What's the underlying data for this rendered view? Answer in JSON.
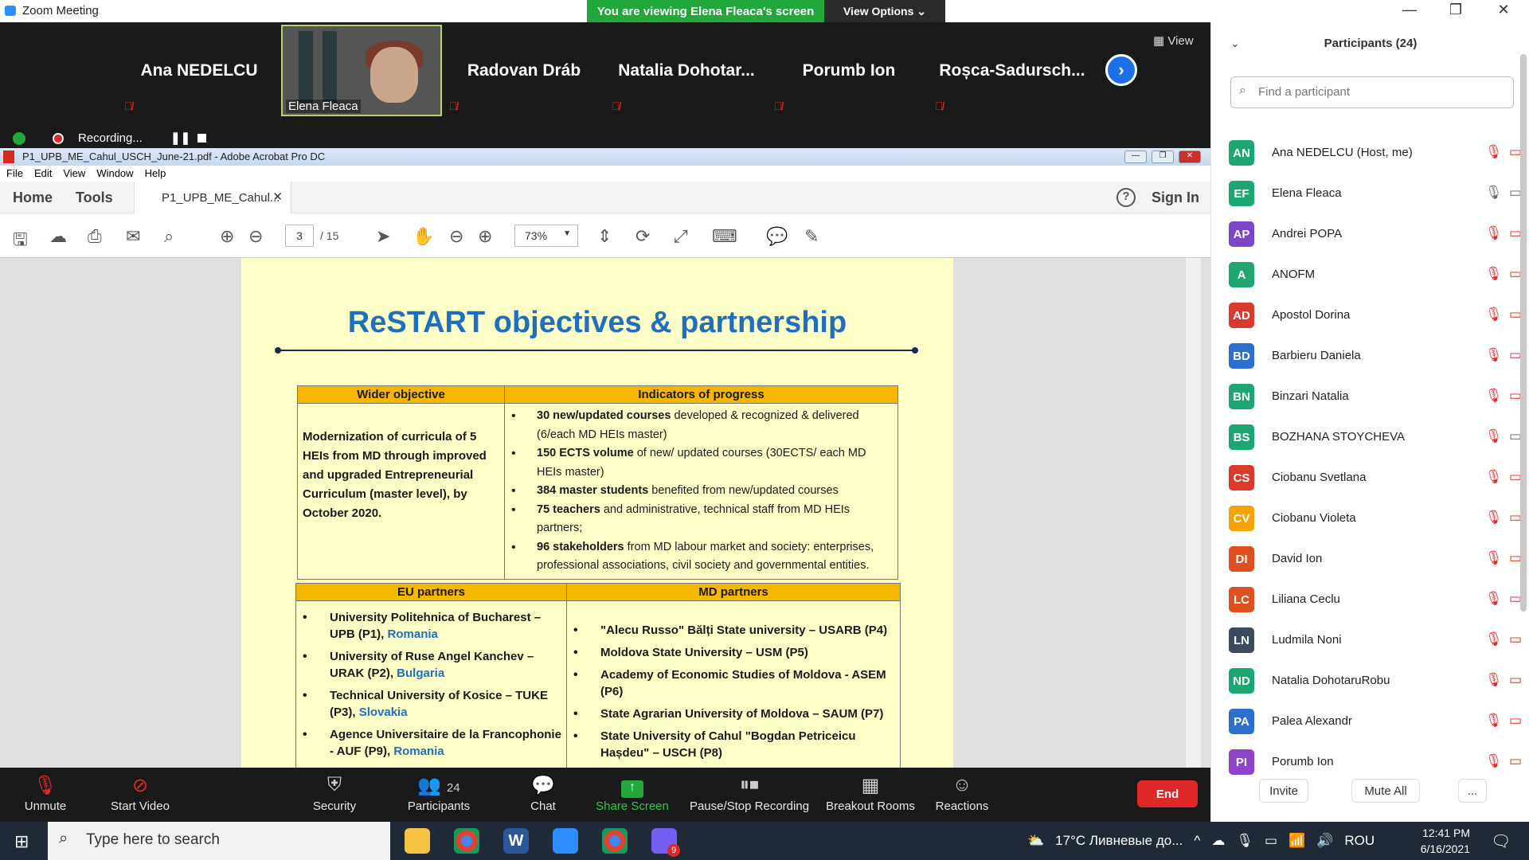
{
  "window": {
    "title": "Zoom Meeting",
    "banner": "You are viewing Elena Fleaca's screen",
    "view_options": "View Options ⌄"
  },
  "strip": {
    "tiles": [
      "Ana NEDELCU",
      "Elena Fleaca",
      "Radovan Dráb",
      "Natalia  Dohotar...",
      "Porumb Ion",
      "Roșca-Sadursch..."
    ],
    "view_label": "View"
  },
  "recording": {
    "label": "Recording..."
  },
  "acrobat": {
    "title": "P1_UPB_ME_Cahul_USCH_June-21.pdf - Adobe Acrobat Pro DC",
    "menu": [
      "File",
      "Edit",
      "View",
      "Window",
      "Help"
    ],
    "home": "Home",
    "tools": "Tools",
    "doc_tab": "P1_UPB_ME_Cahul...",
    "sign_in": "Sign In",
    "page_current": "3",
    "page_total": "/ 15",
    "zoom": "73%"
  },
  "slide": {
    "title": "ReSTART  objectives & partnership",
    "obj_head_left": "Wider objective",
    "obj_head_right": "Indicators of progress",
    "objective": "Modernization of curricula of 5 HEIs from MD through improved and upgraded Entrepreneurial Curriculum (master level), by October 2020.",
    "indicators": [
      {
        "b": "30  new/updated  courses",
        "t": " developed & recognized & delivered (6/each MD HEIs master)"
      },
      {
        "b": "150 ECTS volume",
        "t": " of new/ updated courses (30ECTS/ each MD HEIs master)"
      },
      {
        "b": "384 master students",
        "t": " benefited from new/updated courses"
      },
      {
        "b": "75 teachers",
        "t": " and administrative, technical staff from MD HEIs partners;"
      },
      {
        "b": "96 stakeholders",
        "t": " from MD labour market and society: enterprises, professional associations, civil society and governmental entities."
      }
    ],
    "eu_head": "EU partners",
    "md_head": "MD partners",
    "eu": [
      {
        "t": "University Politehnica of Bucharest – UPB (P1), ",
        "c": "Romania"
      },
      {
        "t": "University of Ruse Angel Kanchev – URAK (P2), ",
        "c": "Bulgaria"
      },
      {
        "t": "Technical University of Kosice – TUKE (P3), ",
        "c": "Slovakia"
      },
      {
        "t": "Agence Universitaire de la Francophonie  - AUF (P9), ",
        "c": "Romania"
      }
    ],
    "md": [
      "\"Alecu Russo\" Bălți State university – USARB (P4)",
      "Moldova State University – USM (P5)",
      "Academy of Economic Studies of Moldova - ASEM (P6)",
      "State Agrarian University of Moldova – SAUM  (P7)",
      "State University of Cahul \"Bogdan Petriceicu Hașdeu\" – USCH (P8)"
    ]
  },
  "controls": {
    "unmute": "Unmute",
    "start_video": "Start Video",
    "security": "Security",
    "participants": "Participants",
    "participants_count": "24",
    "chat": "Chat",
    "share": "Share Screen",
    "pause": "Pause/Stop Recording",
    "breakout": "Breakout Rooms",
    "reactions": "Reactions",
    "end": "End"
  },
  "panel": {
    "header": "Participants (24)",
    "search_placeholder": "Find a participant",
    "people": [
      {
        "i": "AN",
        "n": "Ana NEDELCU (Host, me)",
        "c": "#1ea672"
      },
      {
        "i": "EF",
        "n": "Elena Fleaca",
        "c": "#1ea672"
      },
      {
        "i": "AP",
        "n": "Andrei POPA",
        "c": "#7b46c8"
      },
      {
        "i": "A",
        "n": "ANOFM",
        "c": "#1ea672"
      },
      {
        "i": "AD",
        "n": "Apostol Dorina",
        "c": "#d93a2b"
      },
      {
        "i": "BD",
        "n": "Barbieru Daniela",
        "c": "#2d6fce"
      },
      {
        "i": "BN",
        "n": "Binzari Natalia",
        "c": "#1ea672"
      },
      {
        "i": "BS",
        "n": "BOZHANA STOYCHEVA",
        "c": "#1ea672"
      },
      {
        "i": "CS",
        "n": "Ciobanu Svetlana",
        "c": "#d93a2b"
      },
      {
        "i": "CV",
        "n": "Ciobanu Violeta",
        "c": "#f5a300"
      },
      {
        "i": "DI",
        "n": "David Ion",
        "c": "#e0501e"
      },
      {
        "i": "LC",
        "n": "Liliana Ceclu",
        "c": "#e0501e"
      },
      {
        "i": "LN",
        "n": "Ludmila Noni",
        "c": "#3d4a5c"
      },
      {
        "i": "ND",
        "n": "Natalia DohotaruRobu",
        "c": "#1ea672"
      },
      {
        "i": "PA",
        "n": "Palea Alexandr",
        "c": "#2d6fce"
      },
      {
        "i": "PI",
        "n": "Porumb Ion",
        "c": "#8e44c8"
      }
    ],
    "invite": "Invite",
    "mute_all": "Mute All",
    "more": "..."
  },
  "taskbar": {
    "search": "Type here to search",
    "weather": "17°C  Ливневые до...",
    "lang": "ROU",
    "time": "12:41 PM",
    "date": "6/16/2021",
    "badge": "9"
  }
}
